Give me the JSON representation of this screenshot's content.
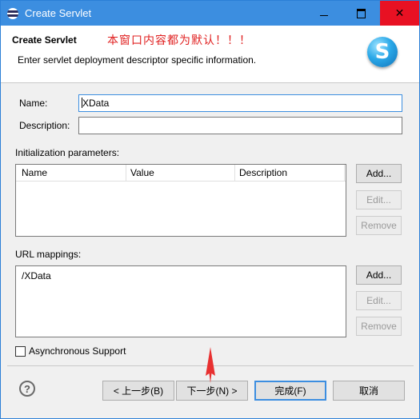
{
  "window": {
    "title": "Create Servlet",
    "minimize_icon": "minimize-icon",
    "maximize_icon": "maximize-icon",
    "close_icon": "close-x-icon",
    "close_glyph": "✕"
  },
  "header": {
    "title": "Create Servlet",
    "note": "本窗口内容都为默认！！！",
    "description": "Enter servlet deployment descriptor specific information.",
    "logo_letter": "S",
    "note_color": "#e02020"
  },
  "form": {
    "name_label": "Name:",
    "name_value": "XData",
    "description_label": "Description:",
    "description_value": ""
  },
  "init_params": {
    "label": "Initialization parameters:",
    "columns": [
      "Name",
      "Value",
      "Description"
    ],
    "rows": [],
    "add_button": "Add...",
    "edit_button": "Edit...",
    "remove_button": "Remove"
  },
  "url_mappings": {
    "label": "URL mappings:",
    "items": [
      "/XData"
    ],
    "add_button": "Add...",
    "edit_button": "Edit...",
    "remove_button": "Remove"
  },
  "async": {
    "label": "Asynchronous Support",
    "checked": false
  },
  "footer": {
    "help_glyph": "?",
    "back_button": "< 上一步(B)",
    "next_button": "下一步(N) >",
    "finish_button": "完成(F)",
    "cancel_button": "取消"
  },
  "colors": {
    "titlebar": "#3c8ee0",
    "close_button": "#e81123",
    "annotation_arrow": "#e83030"
  }
}
